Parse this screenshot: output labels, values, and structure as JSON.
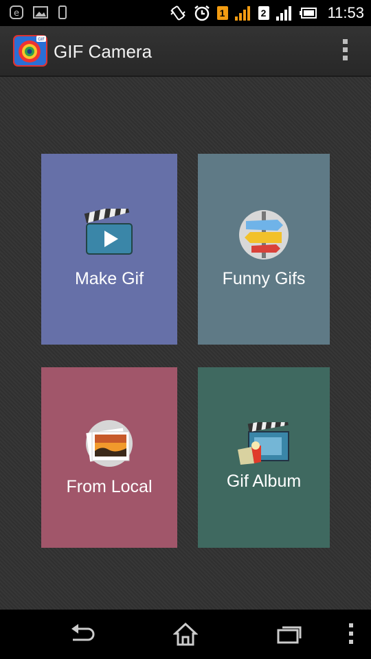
{
  "status_bar": {
    "time": "11:53",
    "sim1_label": "1",
    "sim2_label": "2",
    "icons": [
      "e-notification-icon",
      "image-notification-icon",
      "phone-notification-icon",
      "vibrate-icon",
      "alarm-icon",
      "signal-icon",
      "battery-icon"
    ]
  },
  "action_bar": {
    "title": "GIF Camera",
    "app_icon_badge": "GIF"
  },
  "tiles": [
    {
      "label": "Make Gif",
      "color": "#6670a8",
      "icon": "clapperboard-icon"
    },
    {
      "label": "Funny Gifs",
      "color": "#5f7a86",
      "icon": "signpost-icon"
    },
    {
      "label": "From Local",
      "color": "#a1566a",
      "icon": "photos-icon"
    },
    {
      "label": "Gif Album",
      "color": "#3f6960",
      "icon": "film-album-icon"
    }
  ],
  "nav_bar": {
    "icons": [
      "back-icon",
      "home-icon",
      "recents-icon",
      "menu-icon"
    ]
  }
}
